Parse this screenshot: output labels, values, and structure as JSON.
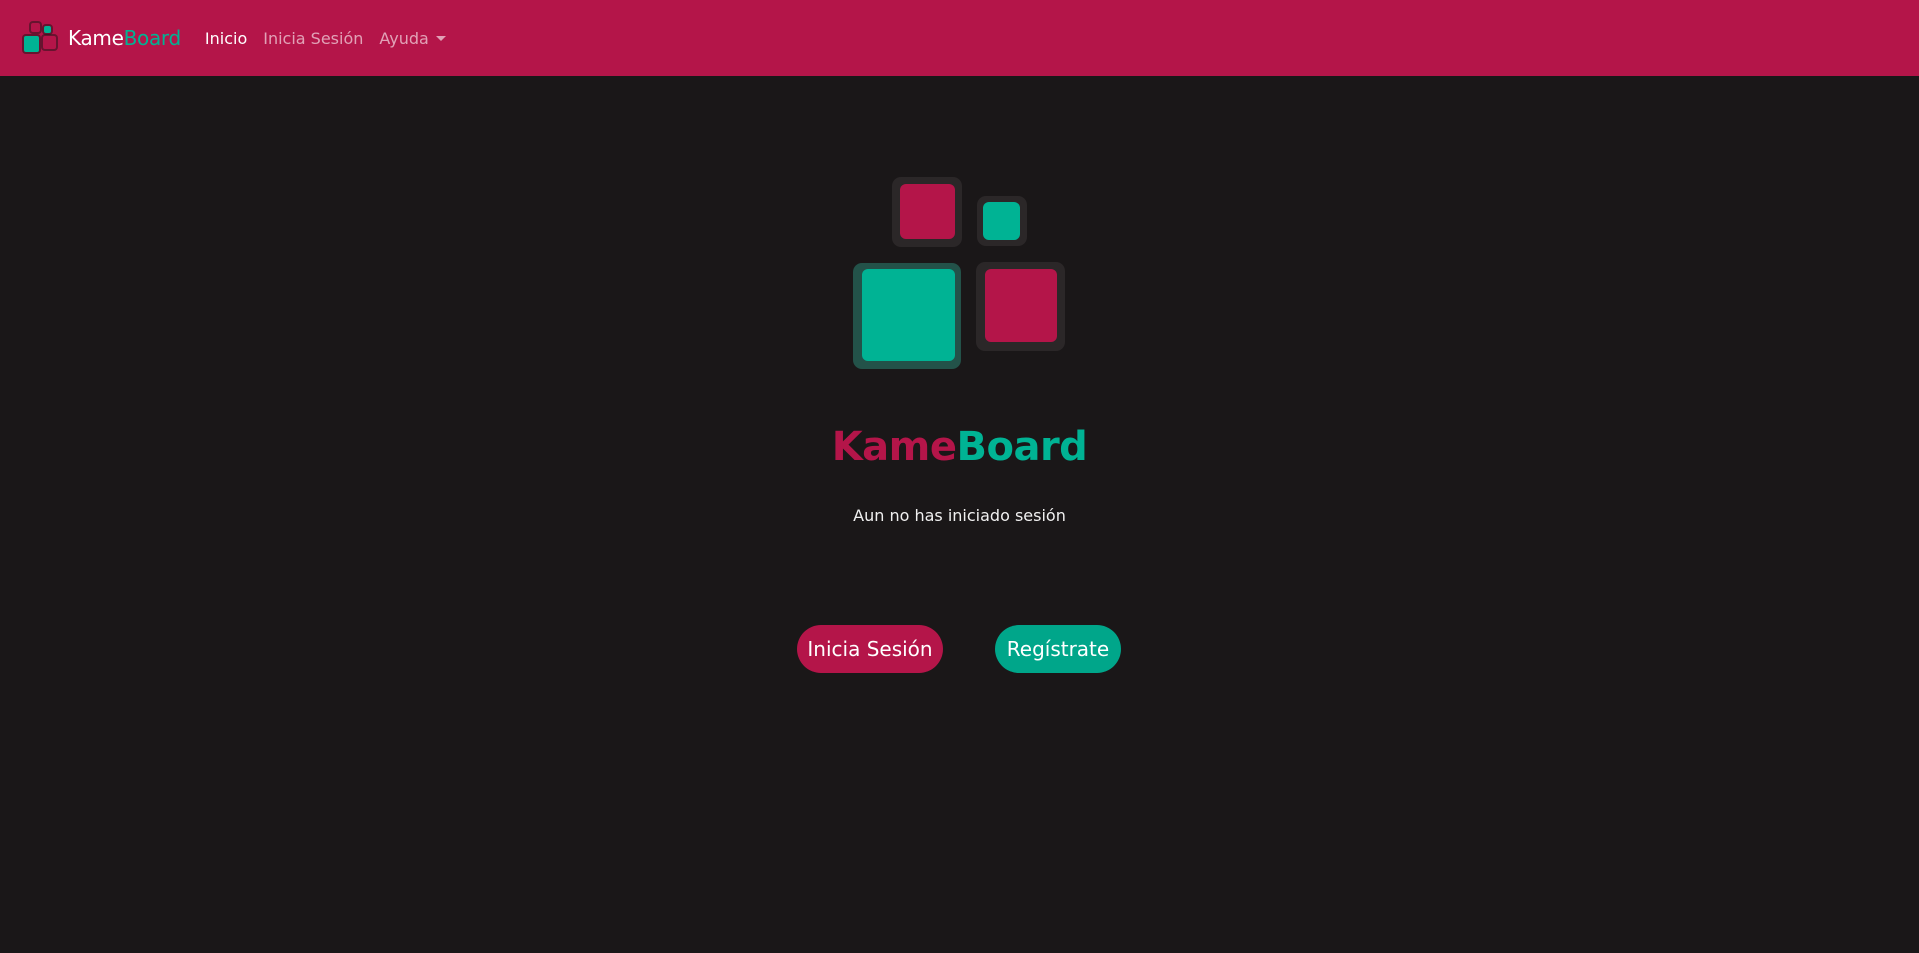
{
  "navbar": {
    "brand": {
      "kame": "Kame",
      "board": "Board"
    },
    "links": [
      {
        "label": "Inicio",
        "active": true
      },
      {
        "label": "Inicia Sesión",
        "active": false
      },
      {
        "label": "Ayuda",
        "active": false,
        "dropdown": true
      }
    ]
  },
  "hero": {
    "title_kame": "Kame",
    "title_board": "Board",
    "status": "Aun no has iniciado sesión"
  },
  "actions": {
    "login_label": "Inicia Sesión",
    "register_label": "Regístrate"
  },
  "colors": {
    "primary": "#b41549",
    "secondary": "#00b394",
    "background": "#1a1718"
  },
  "icons": {
    "brand": "kameboard-logo-icon",
    "hero": "kameboard-logo-icon",
    "dropdown": "caret-down-icon"
  }
}
